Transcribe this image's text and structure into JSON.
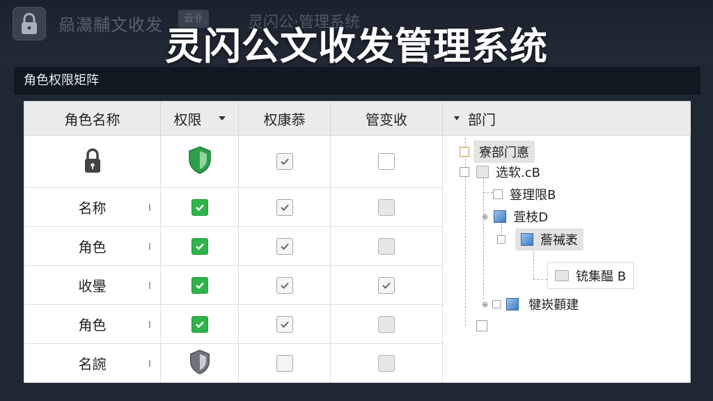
{
  "window": {
    "ghost_title": "赑灊黼文收发",
    "ghost_badge": "云卝",
    "ghost_subtitle": "灵闪公·管理系统",
    "title": "灵闪公文收发管理系统"
  },
  "section": {
    "title": "角色权限矩阵"
  },
  "columns": [
    {
      "label": "角色名称"
    },
    {
      "label": "权限"
    },
    {
      "label": "权康菾"
    },
    {
      "label": "管变收"
    }
  ],
  "rows": [
    {
      "label": "",
      "icon": "lock-icon",
      "perm": "shield-green",
      "c3": "check",
      "c4": "empty"
    },
    {
      "label": "名称",
      "perm": "checked",
      "c3": "check",
      "c4": "filled"
    },
    {
      "label": "角色",
      "perm": "checked",
      "c3": "check",
      "c4": "filled"
    },
    {
      "label": "收璺",
      "perm": "checked",
      "c3": "check",
      "c4": "check"
    },
    {
      "label": "角色",
      "perm": "checked",
      "c3": "check",
      "c4": "filled"
    },
    {
      "label": "名䛷",
      "perm": "shield-gray",
      "c3": "empty",
      "c4": "filled"
    }
  ],
  "tree": {
    "header": "部门",
    "nodes": [
      {
        "label": "寮部门悳"
      },
      {
        "label": "选软.cB"
      },
      {
        "label": "簦理限B"
      },
      {
        "label": "萓枝D"
      },
      {
        "label": "薝祴袤"
      },
      {
        "label": "铳集醖 B"
      },
      {
        "label": "犍崁顴建"
      },
      {
        "label": ""
      }
    ]
  },
  "colors": {
    "background": "#1f2733",
    "header_bar": "#111820",
    "check_green": "#2fb34a",
    "shield_green": "#2e9e4a",
    "tree_blue": "#3b7cc4"
  }
}
